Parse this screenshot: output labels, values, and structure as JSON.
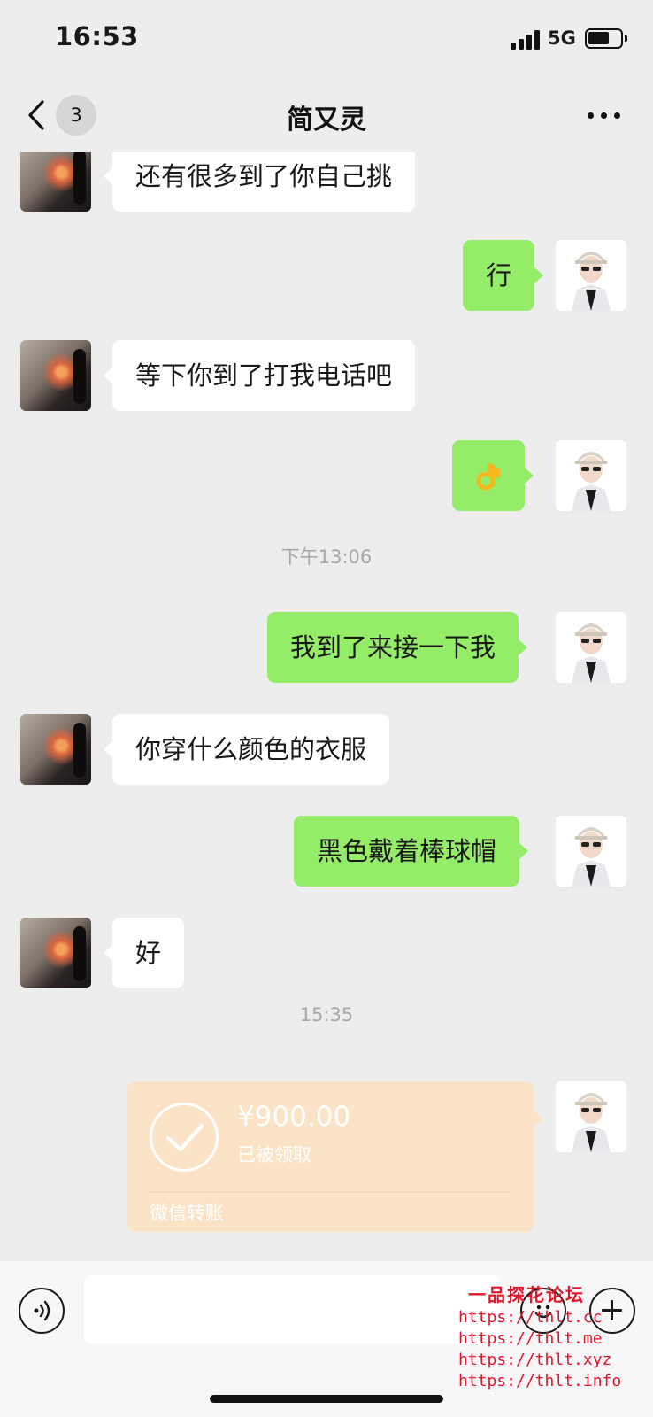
{
  "status_bar": {
    "time": "16:53",
    "network": "5G"
  },
  "nav": {
    "unread_count": "3",
    "title": "简又灵"
  },
  "messages": [
    {
      "side": "left",
      "text": "还有很多到了你自己挑"
    },
    {
      "side": "right",
      "text": "行"
    },
    {
      "side": "left",
      "text": "等下你到了打我电话吧"
    },
    {
      "side": "right",
      "emoji": "ok-hand"
    },
    {
      "side": "right",
      "text": "我到了来接一下我"
    },
    {
      "side": "left",
      "text": "你穿什么颜色的衣服"
    },
    {
      "side": "right",
      "text": "黑色戴着棒球帽"
    },
    {
      "side": "left",
      "text": "好"
    }
  ],
  "timestamps": [
    "下午13:06",
    "15:35"
  ],
  "transfer": {
    "amount": "¥900.00",
    "status": "已被领取",
    "label": "微信转账"
  },
  "input_bar": {
    "value": ""
  },
  "watermark": {
    "title": "一品探花论坛",
    "links": [
      "https://thlt.cc",
      "https://thlt.me",
      "https://thlt.xyz",
      "https://thlt.info"
    ]
  },
  "colors": {
    "background": "#ededed",
    "sent_bubble": "#95ec69",
    "received_bubble": "#ffffff",
    "transfer_card": "#fae3c6",
    "watermark": "#e0162b"
  }
}
